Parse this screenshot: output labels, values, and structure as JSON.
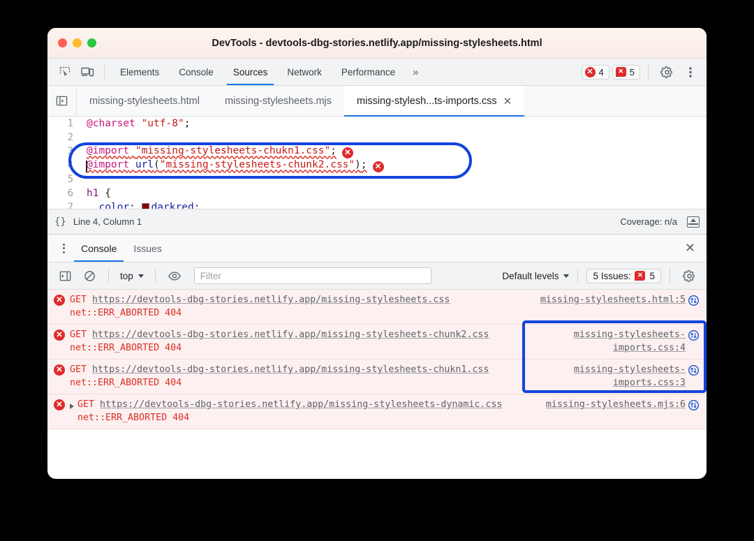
{
  "window": {
    "title": "DevTools - devtools-dbg-stories.netlify.app/missing-stylesheets.html"
  },
  "toolbar": {
    "inspect_icon": "inspect-element-icon",
    "device_icon": "device-toolbar-icon",
    "panels": [
      {
        "label": "Elements",
        "active": false
      },
      {
        "label": "Console",
        "active": false
      },
      {
        "label": "Sources",
        "active": true
      },
      {
        "label": "Network",
        "active": false
      },
      {
        "label": "Performance",
        "active": false
      }
    ],
    "more_panels": "»",
    "error_count": "4",
    "issue_count": "5",
    "error_glyph": "✕",
    "issue_glyph": "✕",
    "settings_icon": "gear-icon",
    "menu_icon": "kebab-menu-icon"
  },
  "file_tabs": {
    "navigator_icon": "show-navigator-icon",
    "items": [
      {
        "label": "missing-stylesheets.html",
        "active": false,
        "closable": false
      },
      {
        "label": "missing-stylesheets.mjs",
        "active": false,
        "closable": false
      },
      {
        "label": "missing-stylesh...ts-imports.css",
        "active": true,
        "closable": true
      }
    ],
    "close_glyph": "✕"
  },
  "editor": {
    "lines": [
      {
        "num": "1",
        "segments": [
          {
            "text": "@charset",
            "cls": "tok-at"
          },
          {
            "text": " ",
            "cls": "tok-punct"
          },
          {
            "text": "\"utf-8\"",
            "cls": "tok-str"
          },
          {
            "text": ";",
            "cls": "tok-punct"
          }
        ]
      },
      {
        "num": "2",
        "segments": []
      },
      {
        "num": "3",
        "segments": [
          {
            "text": "@import",
            "cls": "tok-at squiggle"
          },
          {
            "text": " ",
            "cls": "tok-punct squiggle"
          },
          {
            "text": "\"missing-stylesheets-chukn1.css\"",
            "cls": "tok-str squiggle"
          },
          {
            "text": ";",
            "cls": "tok-punct squiggle"
          }
        ],
        "error_badge": "✕"
      },
      {
        "num": "4",
        "segments": [
          {
            "text": "@import",
            "cls": "tok-at squiggle"
          },
          {
            "text": " ",
            "cls": "tok-punct squiggle"
          },
          {
            "text": "url",
            "cls": "tok-fn squiggle"
          },
          {
            "text": "(",
            "cls": "tok-punct squiggle"
          },
          {
            "text": "\"missing-stylesheets-chunk2.css\"",
            "cls": "tok-str squiggle"
          },
          {
            "text": ")",
            "cls": "tok-punct squiggle"
          },
          {
            "text": ";",
            "cls": "tok-punct squiggle"
          }
        ],
        "error_badge": "✕",
        "caret": true
      },
      {
        "num": "5",
        "segments": []
      },
      {
        "num": "6",
        "segments": [
          {
            "text": "h1",
            "cls": "tok-sel"
          },
          {
            "text": " {",
            "cls": "tok-punct"
          }
        ]
      },
      {
        "num": "7",
        "segments": [
          {
            "text": "  color",
            "cls": "tok-prop"
          },
          {
            "text": ": ",
            "cls": "tok-punct"
          },
          {
            "text": "SWATCH",
            "cls": "swatch-marker"
          },
          {
            "text": "darkred",
            "cls": "tok-val"
          },
          {
            "text": ";",
            "cls": "tok-punct"
          }
        ]
      }
    ],
    "swatch_color": "#8b0000",
    "highlight_color": "#1144dd"
  },
  "statusbar": {
    "format_icon": "{}",
    "cursor_position": "Line 4, Column 1",
    "coverage": "Coverage: n/a",
    "dock_icon": "dock-to-bottom-icon"
  },
  "drawer": {
    "menu_icon": "kebab-menu-icon",
    "tabs": [
      {
        "label": "Console",
        "active": true
      },
      {
        "label": "Issues",
        "active": false
      }
    ],
    "close_glyph": "✕"
  },
  "console_toolbar": {
    "sidebar_icon": "console-sidebar-icon",
    "clear_icon": "clear-console-icon",
    "context": "top",
    "eye_icon": "live-expression-icon",
    "filter_placeholder": "Filter",
    "filter_value": "",
    "levels": "Default levels",
    "issues_label": "5 Issues:",
    "issues_count": "5",
    "issues_glyph": "✕",
    "settings_icon": "gear-icon"
  },
  "console_messages": [
    {
      "icon_glyph": "✕",
      "expandable": false,
      "method": "GET",
      "url": "https://devtools-dbg-stories.netlify.app/missing-stylesheets.css",
      "error": "net::ERR_ABORTED 404",
      "source": "missing-stylesheets.html:5",
      "net_icon": "network-request-icon",
      "highlighted": false
    },
    {
      "icon_glyph": "✕",
      "expandable": false,
      "method": "GET",
      "url": "https://devtools-dbg-stories.netlify.app/missing-stylesheets-chunk2.css",
      "error": "net::ERR_ABORTED 404",
      "source": "missing-stylesheets-imports.css:4",
      "net_icon": "network-request-icon",
      "highlighted": true
    },
    {
      "icon_glyph": "✕",
      "expandable": false,
      "method": "GET",
      "url": "https://devtools-dbg-stories.netlify.app/missing-stylesheets-chukn1.css",
      "error": "net::ERR_ABORTED 404",
      "source": "missing-stylesheets-imports.css:3",
      "net_icon": "network-request-icon",
      "highlighted": true
    },
    {
      "icon_glyph": "✕",
      "expandable": true,
      "method": "GET",
      "url": "https://devtools-dbg-stories.netlify.app/missing-stylesheets-dynamic.css",
      "error": "net::ERR_ABORTED 404",
      "source": "missing-stylesheets.mjs:6",
      "net_icon": "network-request-icon",
      "highlighted": false
    }
  ],
  "console_prompt": {
    "chevron": "›",
    "value": ""
  },
  "colors": {
    "accent": "#1a73e8",
    "error": "#dd2c2c",
    "highlight": "#1144dd",
    "error_bg": "#fdf0f0"
  }
}
